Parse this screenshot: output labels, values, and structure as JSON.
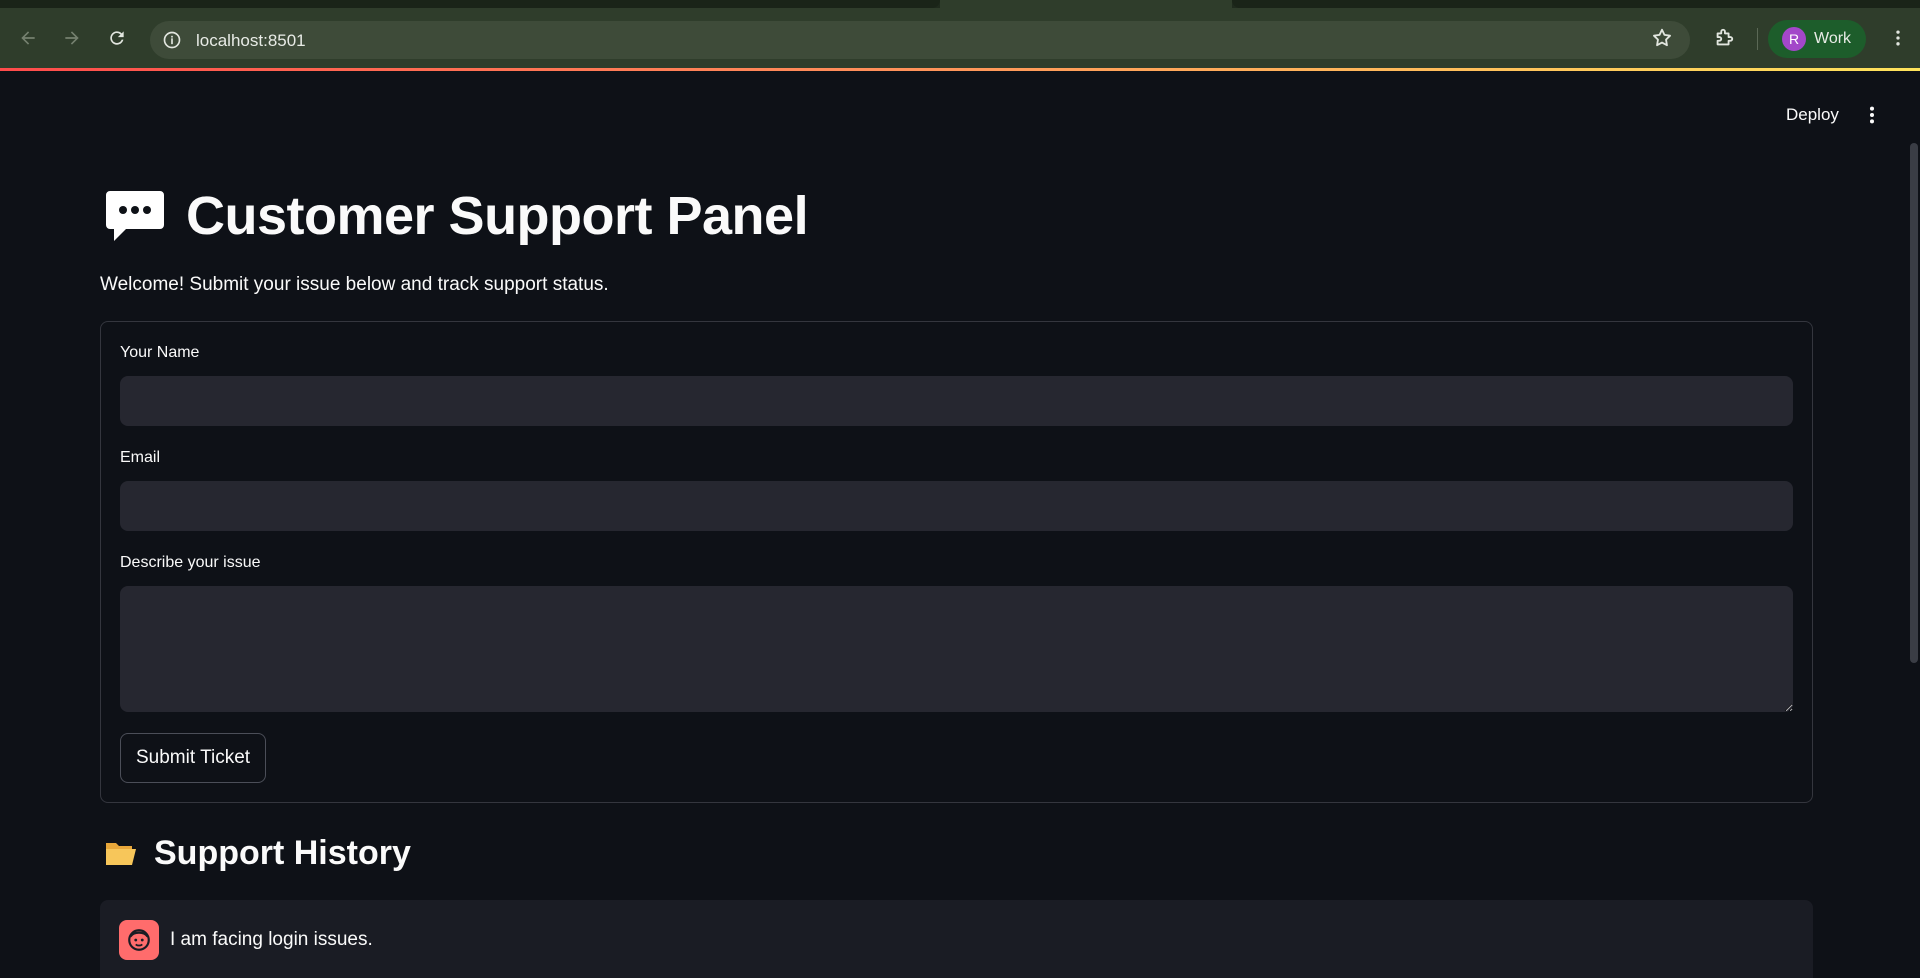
{
  "browser": {
    "url": "localhost:8501",
    "profile_initial": "R",
    "profile_name": "Work"
  },
  "header": {
    "deploy_label": "Deploy"
  },
  "main": {
    "title": "Customer Support Panel",
    "welcome": "Welcome! Submit your issue below and track support status.",
    "form": {
      "name_label": "Your Name",
      "name_value": "",
      "email_label": "Email",
      "email_value": "",
      "issue_label": "Describe your issue",
      "issue_value": "",
      "submit_label": "Submit Ticket"
    },
    "history": {
      "title": "Support History",
      "messages": [
        {
          "text": "I am facing login issues."
        }
      ]
    }
  },
  "colors": {
    "background": "#0e1117",
    "input_bg": "#262730",
    "accent_red": "#ff4b4b",
    "avatar_red": "#ff6c6c",
    "profile_purple": "#a347c9"
  },
  "icons": {
    "title": "speech-bubble-icon",
    "history": "open-folder-icon",
    "message_avatar": "user-face-icon"
  }
}
